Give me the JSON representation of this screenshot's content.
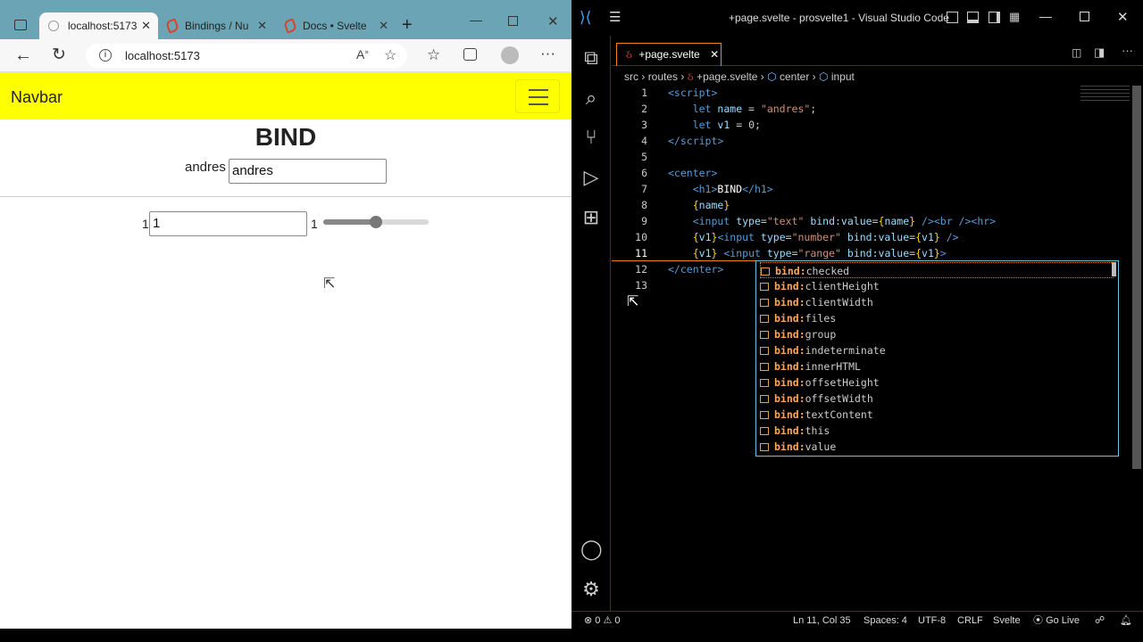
{
  "browser": {
    "tabs": [
      {
        "title": "localhost:5173",
        "active": true
      },
      {
        "title": "Bindings / Nu"
      },
      {
        "title": "Docs • Svelte"
      }
    ],
    "address": "localhost:5173",
    "page": {
      "navbar_brand": "Navbar",
      "heading": "BIND",
      "name_label": "andres",
      "name_value": "andres",
      "number_label": "1",
      "number_value": "1",
      "range_label": "1",
      "range_fraction": 0.5
    }
  },
  "vscode": {
    "title": "+page.svelte - prosvelte1 - Visual Studio Code",
    "tab": "+page.svelte",
    "breadcrumb": [
      "src",
      "routes",
      "+page.svelte",
      "center",
      "input"
    ],
    "line_numbers": [
      "1",
      "2",
      "3",
      "4",
      "5",
      "6",
      "7",
      "8",
      "9",
      "10",
      "11",
      "12",
      "13"
    ],
    "suggestions": [
      "checked",
      "clientHeight",
      "clientWidth",
      "files",
      "group",
      "indeterminate",
      "innerHTML",
      "offsetHeight",
      "offsetWidth",
      "textContent",
      "this",
      "value"
    ],
    "suggestion_prefix": "bind:",
    "status": {
      "errors": "0",
      "warnings": "0",
      "position": "Ln 11, Col 35",
      "spaces": "Spaces: 4",
      "encoding": "UTF-8",
      "eol": "CRLF",
      "language": "Svelte",
      "golive": "Go Live"
    }
  }
}
